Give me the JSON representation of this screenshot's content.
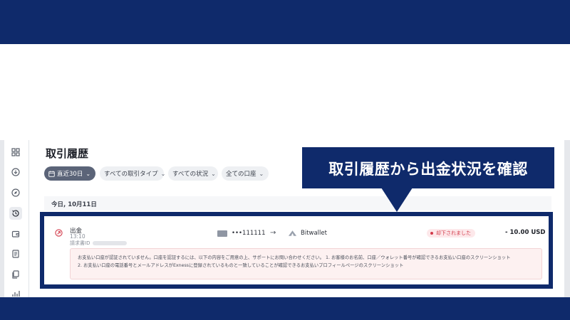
{
  "page": {
    "title": "取引履歴"
  },
  "filters": [
    {
      "label": "直近30日",
      "selected": true
    },
    {
      "label": "すべての取引タイプ",
      "selected": false
    },
    {
      "label": "すべての状況",
      "selected": false
    },
    {
      "label": "全ての口座",
      "selected": false
    }
  ],
  "date_group": {
    "label": "今日, 10月11日"
  },
  "transaction": {
    "type": "出金",
    "time": "13:10",
    "request_id_label": "請求書ID",
    "account_number": "•••111111",
    "destination": "Bitwallet",
    "status": "却下されました",
    "amount": "- 10.00 USD",
    "message_lines": [
      "お支払い口座が認証されていません。口座を認証するには、以下の内容をご用意の上、サポートにお問い合わせください。 1. お客様のお名前、口座／ウォレット番号が確認できるお支払い口座のスクリーンショット",
      "2. お支払い口座の電話番号とメールアドレスがExnessに登録されているものと一致していることが確認できるお支払いプロフィールページのスクリーンショット"
    ]
  },
  "callout": {
    "text": "取引履歴から出金状況を確認"
  },
  "sidebar": {
    "icons": [
      "dashboard-icon",
      "download-icon",
      "compass-icon",
      "history-icon",
      "wallet-icon",
      "document-icon",
      "copy-icon",
      "chart-icon"
    ],
    "active": "history-icon"
  },
  "colors": {
    "band": "#0f2a6b",
    "status_red": "#d23a4a",
    "selected_chip": "#5b6478"
  }
}
